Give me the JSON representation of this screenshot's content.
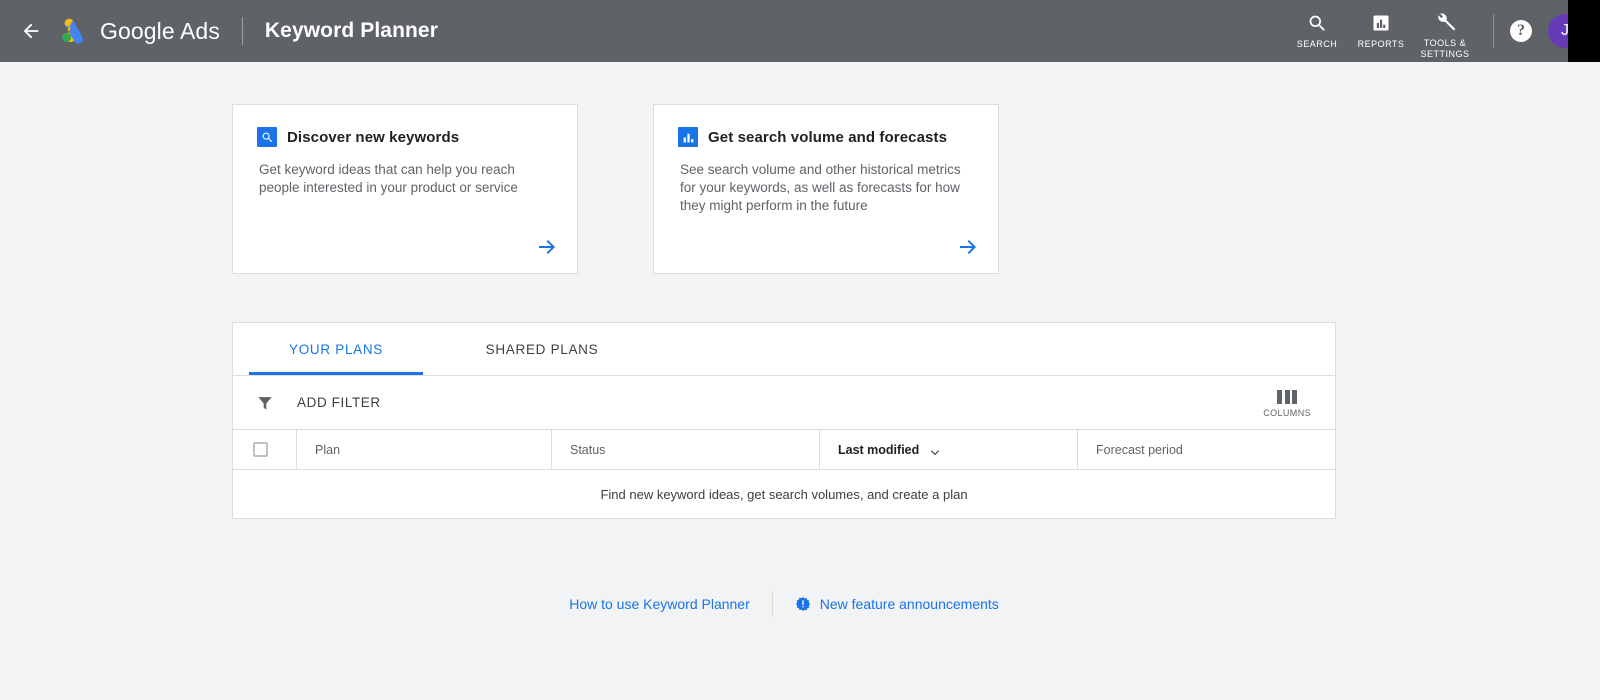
{
  "appbar": {
    "back_icon": "back-arrow-icon",
    "logo_icon": "google-ads-logo",
    "brand": "Google Ads",
    "page_title": "Keyword Planner",
    "tools": [
      {
        "label": "SEARCH",
        "icon": "search-icon"
      },
      {
        "label": "REPORTS",
        "icon": "reports-bar-chart-icon"
      },
      {
        "label": "TOOLS &\nSETTINGS",
        "icon": "wrench-icon"
      }
    ],
    "help_label": "?",
    "avatar_initial": "J",
    "avatar_color": "#673ab7",
    "background": "#5f6368"
  },
  "cards": [
    {
      "icon": "search-square-icon",
      "title": "Discover new keywords",
      "body": "Get keyword ideas that can help you reach people interested in your product or service",
      "arrow_icon": "arrow-right-icon"
    },
    {
      "icon": "bar-chart-square-icon",
      "title": "Get search volume and forecasts",
      "body": "See search volume and other historical metrics for your keywords, as well as forecasts for how they might perform in the future",
      "arrow_icon": "arrow-right-icon"
    }
  ],
  "plans": {
    "tabs": [
      {
        "label": "YOUR PLANS",
        "active": true
      },
      {
        "label": "SHARED PLANS",
        "active": false
      }
    ],
    "filter": {
      "icon": "filter-funnel-icon",
      "label": "ADD FILTER"
    },
    "columns": {
      "icon": "columns-icon",
      "label": "COLUMNS"
    },
    "table": {
      "select_all": "select-all-checkbox",
      "headers": [
        {
          "label": "Plan",
          "sorted": false
        },
        {
          "label": "Status",
          "sorted": false
        },
        {
          "label": "Last modified",
          "sorted": true,
          "sort_icon": "sort-descending-arrow"
        },
        {
          "label": "Forecast period",
          "sorted": false
        }
      ],
      "rows": [],
      "empty_message": "Find new keyword ideas, get search volumes, and create a plan"
    }
  },
  "footer": {
    "links": [
      {
        "label": "How to use Keyword Planner",
        "icon": null
      },
      {
        "label": "New feature announcements",
        "icon": "new-feature-badge-icon"
      }
    ]
  },
  "colors": {
    "accent": "#1a73e8",
    "appbar": "#5f6368",
    "page_background": "#f1f3f4",
    "border": "#dadce0"
  }
}
